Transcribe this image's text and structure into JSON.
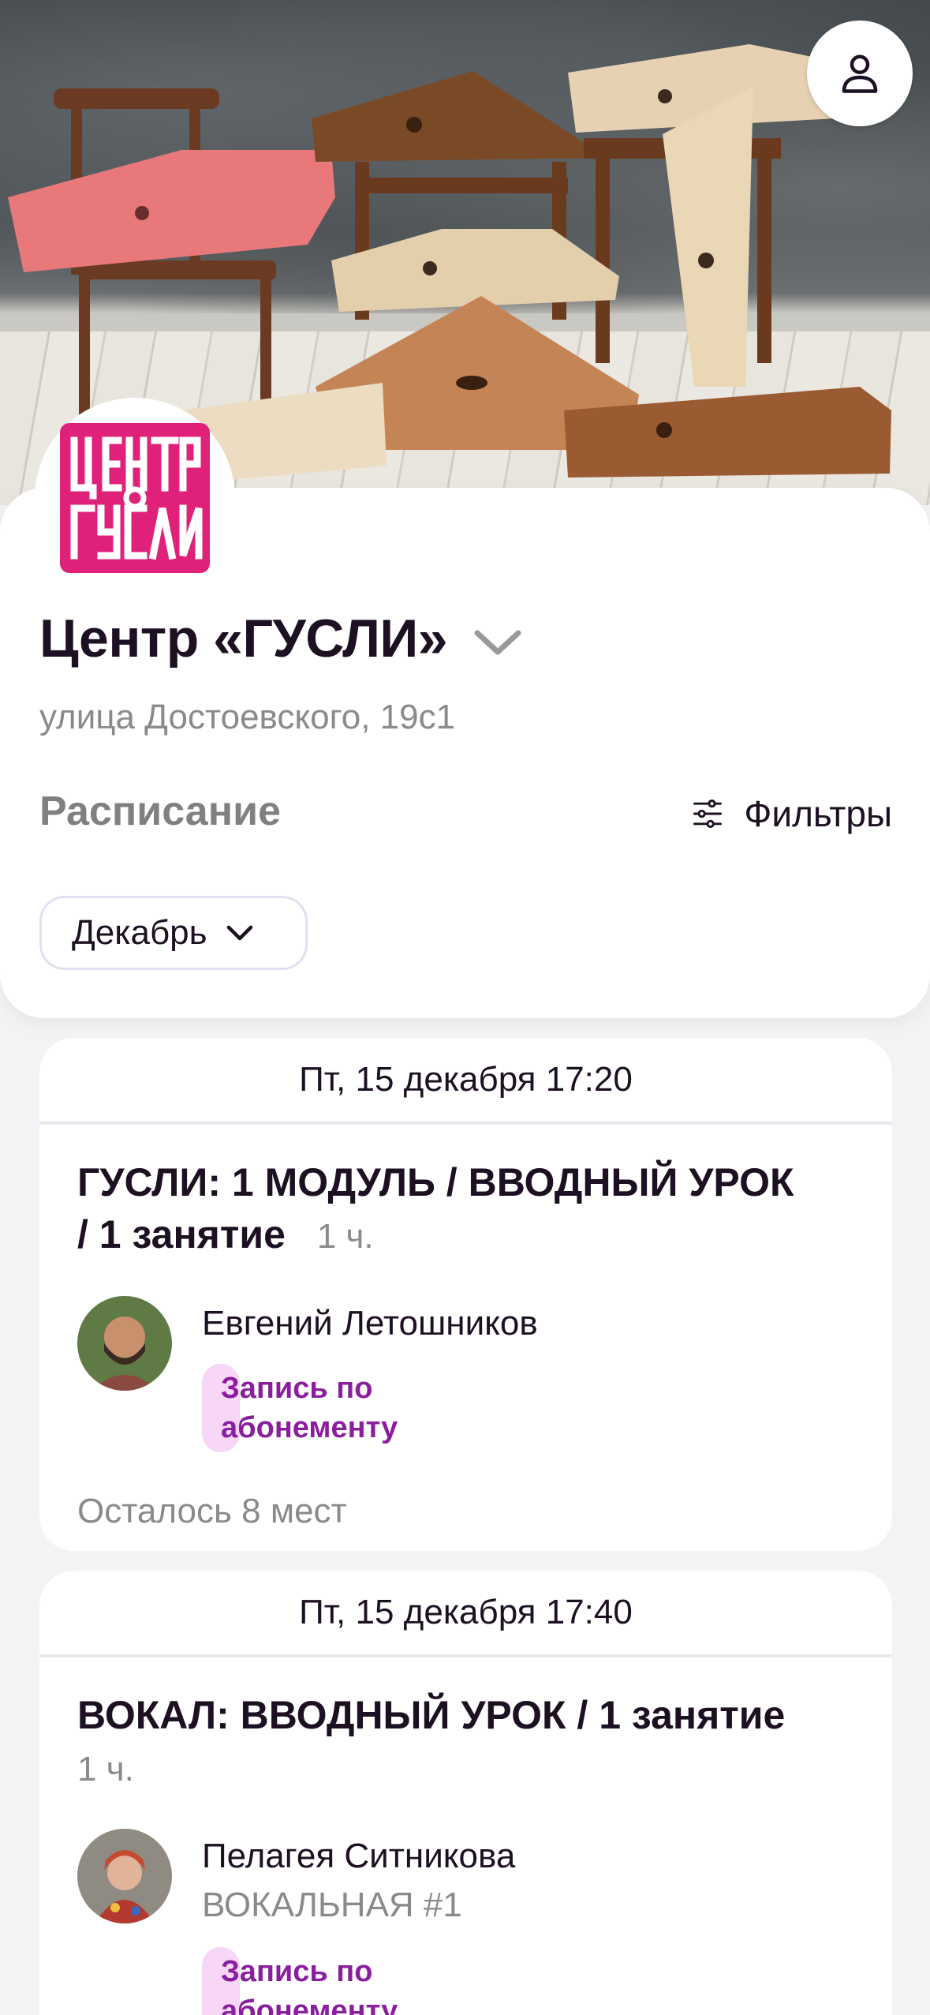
{
  "header": {
    "profile_icon": "user-icon"
  },
  "venue": {
    "logo_text": "ЦЕНТР ГУСЛИ",
    "logo_color": "#e0217a",
    "title": "Центр «ГУСЛИ»",
    "address": "улица Достоевского, 19с1"
  },
  "schedule": {
    "label": "Расписание",
    "filters_label": "Фильтры",
    "month": "Декабрь"
  },
  "events": [
    {
      "date": "Пт, 15 декабря 17:20",
      "title_line1": "ГУСЛИ: 1 МОДУЛЬ / ВВОДНЫЙ УРОК",
      "title_line2": "/ 1 занятие",
      "duration": "1 ч.",
      "teacher": "Евгений Летошников",
      "badge_line1": "Запись по",
      "badge_line2": "абонементу",
      "seats": "Осталось 8 мест"
    },
    {
      "date": "Пт, 15 декабря 17:40",
      "title_line1": "ВОКАЛ: ВВОДНЫЙ УРОК / 1 занятие",
      "duration": "1 ч.",
      "teacher": "Пелагея Ситникова",
      "teacher_sub": "ВОКАЛЬНАЯ #1",
      "badge_line1": "Запись по",
      "badge_line2": "абонементу"
    }
  ],
  "colors": {
    "accent": "#8a1f9e",
    "badge_bg": "#f8d6f5",
    "muted": "#8a8a8a"
  }
}
